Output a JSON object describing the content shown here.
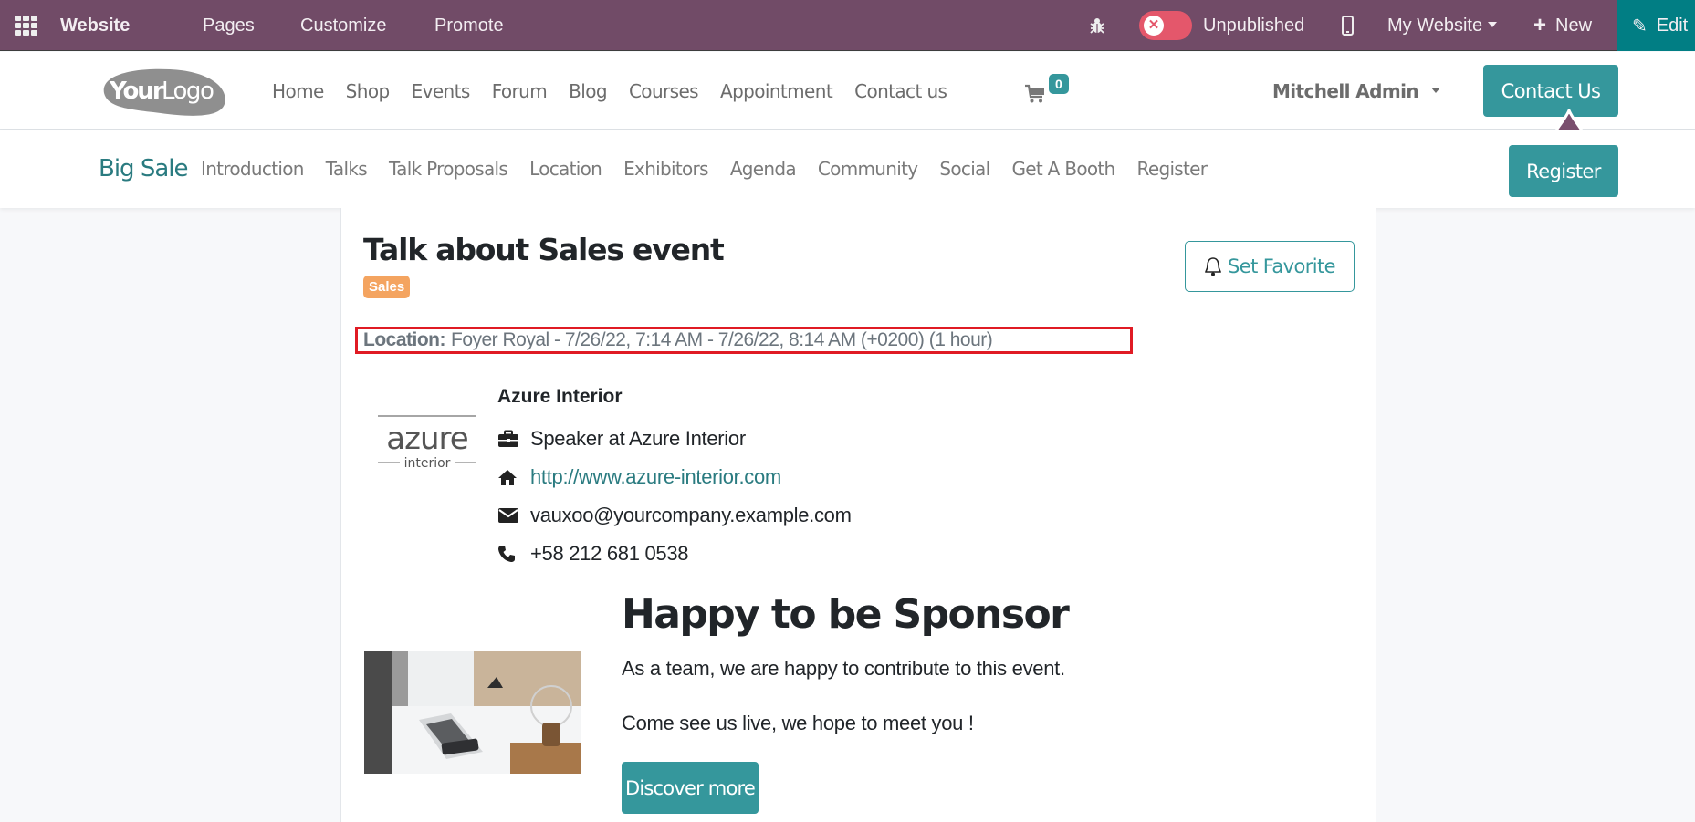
{
  "topbar": {
    "app_name": "Website",
    "menu": [
      "Pages",
      "Customize",
      "Promote"
    ],
    "publish_status": "Unpublished",
    "website_selector": "My Website",
    "new_label": "New",
    "edit_label": "Edit",
    "colors": {
      "bar": "#714B67",
      "edit": "#017E84",
      "toggle_off": "#E4576B"
    }
  },
  "header": {
    "logo_text_bold": "Your",
    "logo_text_light": "Logo",
    "nav": [
      "Home",
      "Shop",
      "Events",
      "Forum",
      "Blog",
      "Courses",
      "Appointment",
      "Contact us"
    ],
    "cart_count": "0",
    "user_name": "Mitchell Admin",
    "cta_label": "Contact Us"
  },
  "event_nav": {
    "event_name": "Big Sale",
    "links": [
      "Introduction",
      "Talks",
      "Talk Proposals",
      "Location",
      "Exhibitors",
      "Agenda",
      "Community",
      "Social",
      "Get A Booth",
      "Register"
    ],
    "register_label": "Register"
  },
  "talk": {
    "title": "Talk about Sales event",
    "tag": "Sales",
    "favorite_label": "Set Favorite",
    "location_label": "Location:",
    "location_value": "Foyer Royal - 7/26/22, 7:14 AM - 7/26/22, 8:14 AM (+0200) (1 hour)"
  },
  "speaker": {
    "logo_main": "azure",
    "logo_sub": "interior",
    "name": "Azure Interior",
    "function": "Speaker at Azure Interior",
    "website": "http://www.azure-interior.com",
    "email": "vauxoo@yourcompany.example.com",
    "phone": "+58 212 681 0538"
  },
  "sponsor": {
    "heading": "Happy to be Sponsor",
    "text1": "As a team, we are happy to contribute to this event.",
    "text2": "Come see us live, we hope to meet you !",
    "button_label": "Discover more"
  },
  "theme": {
    "primary": "#35979C",
    "link": "#2A7B80",
    "tag": "#F4A460",
    "highlight_box": "#E01B24"
  }
}
